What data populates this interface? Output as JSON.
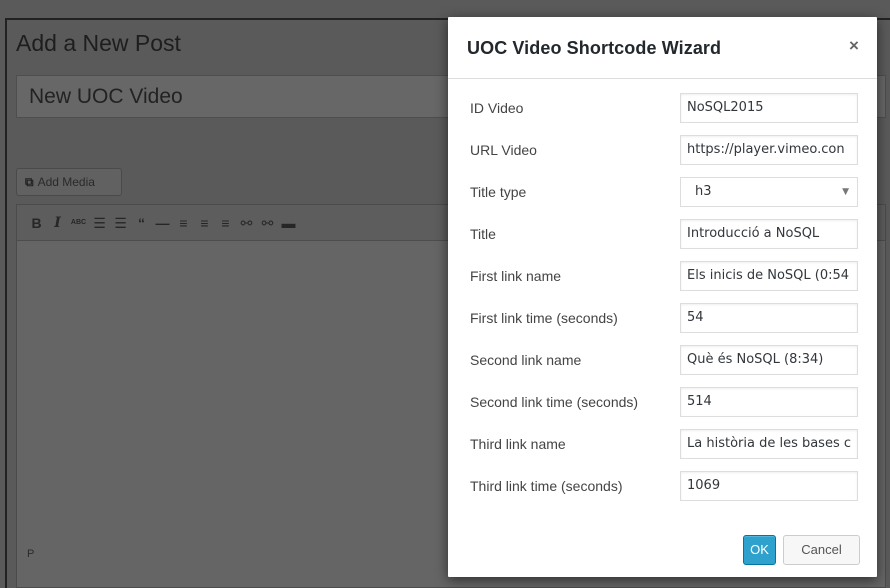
{
  "editor": {
    "page_heading": "Add a New Post",
    "post_title_value": "New UOC Video",
    "add_media_label": "Add Media",
    "add_media_icon": "media-icon",
    "toolbar": [
      {
        "glyph": "B",
        "icon": "bold-icon"
      },
      {
        "glyph": "I",
        "icon": "italic-icon"
      },
      {
        "glyph": "ABC",
        "icon": "strikethrough-icon"
      },
      {
        "glyph": "☰",
        "icon": "bullet-list-icon"
      },
      {
        "glyph": "☰",
        "icon": "numbered-list-icon"
      },
      {
        "glyph": "“",
        "icon": "blockquote-icon"
      },
      {
        "glyph": "—",
        "icon": "horizontal-rule-icon"
      },
      {
        "glyph": "≡",
        "icon": "align-left-icon"
      },
      {
        "glyph": "≡",
        "icon": "align-center-icon"
      },
      {
        "glyph": "≡",
        "icon": "align-right-icon"
      },
      {
        "glyph": "⚯",
        "icon": "link-icon"
      },
      {
        "glyph": "⚯",
        "icon": "unlink-icon"
      },
      {
        "glyph": "▬",
        "icon": "read-more-icon"
      }
    ],
    "status_path": "P"
  },
  "modal": {
    "title": "UOC Video Shortcode Wizard",
    "close_glyph": "×",
    "fields": [
      {
        "label": "ID Video",
        "value": "NoSQL2015",
        "type": "input"
      },
      {
        "label": "URL Video",
        "value": "https://player.vimeo.con",
        "type": "input"
      },
      {
        "label": "Title type",
        "value": "h3",
        "type": "select"
      },
      {
        "label": "Title",
        "value": "Introducció a NoSQL",
        "type": "input"
      },
      {
        "label": "First link name",
        "value": "Els inicis de NoSQL (0:54",
        "type": "input"
      },
      {
        "label": "First link time (seconds)",
        "value": "54",
        "type": "input"
      },
      {
        "label": "Second link name",
        "value": "Què és NoSQL (8:34)",
        "type": "input"
      },
      {
        "label": "Second link time (seconds)",
        "value": "514",
        "type": "input"
      },
      {
        "label": "Third link name",
        "value": "La història de les bases c",
        "type": "input"
      },
      {
        "label": "Third link time (seconds)",
        "value": "1069",
        "type": "input"
      }
    ],
    "ok_label": "OK",
    "cancel_label": "Cancel"
  },
  "colors": {
    "primary_button": "#2ea2cc",
    "overlay": "#595959"
  }
}
